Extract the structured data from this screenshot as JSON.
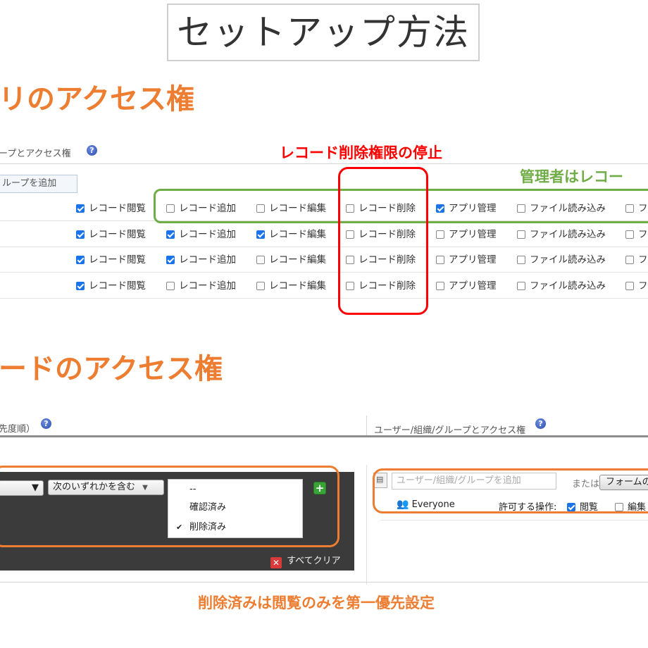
{
  "page_title": "セットアップ方法",
  "app_section": {
    "heading": "リのアクセス権",
    "column_header": "ープとアクセス権",
    "add_group_placeholder": "ループを追加",
    "annotation_red": "レコード削除権限の停止",
    "annotation_green": "管理者はレコー",
    "rows": [
      [
        {
          "label": "レコード閲覧",
          "checked": true
        },
        {
          "label": "レコード追加",
          "checked": false
        },
        {
          "label": "レコード編集",
          "checked": false
        },
        {
          "label": "レコード削除",
          "checked": false
        },
        {
          "label": "アプリ管理",
          "checked": true
        },
        {
          "label": "ファイル読み込み",
          "checked": false
        },
        {
          "label": "フ",
          "checked": false
        }
      ],
      [
        {
          "label": "レコード閲覧",
          "checked": true
        },
        {
          "label": "レコード追加",
          "checked": true
        },
        {
          "label": "レコード編集",
          "checked": true
        },
        {
          "label": "レコード削除",
          "checked": false
        },
        {
          "label": "アプリ管理",
          "checked": false
        },
        {
          "label": "ファイル読み込み",
          "checked": false
        },
        {
          "label": "フ",
          "checked": false
        }
      ],
      [
        {
          "label": "レコード閲覧",
          "checked": true
        },
        {
          "label": "レコード追加",
          "checked": true
        },
        {
          "label": "レコード編集",
          "checked": false
        },
        {
          "label": "レコード削除",
          "checked": false
        },
        {
          "label": "アプリ管理",
          "checked": false
        },
        {
          "label": "ファイル読み込み",
          "checked": false
        },
        {
          "label": "フ",
          "checked": false
        }
      ],
      [
        {
          "label": "レコード閲覧",
          "checked": true
        },
        {
          "label": "レコード追加",
          "checked": false
        },
        {
          "label": "レコード編集",
          "checked": false
        },
        {
          "label": "レコード削除",
          "checked": false
        },
        {
          "label": "アプリ管理",
          "checked": false
        },
        {
          "label": "ファイル読み込み",
          "checked": false
        },
        {
          "label": "フ",
          "checked": false
        }
      ]
    ]
  },
  "record_section": {
    "heading": "ードのアクセス権",
    "left_header": "先度順）",
    "right_header": "ユーザー/組織/グループとアクセス権",
    "condition_select": "次のいずれかを含む",
    "dropdown_options": [
      {
        "label": "--",
        "selected": false
      },
      {
        "label": "確認済み",
        "selected": false
      },
      {
        "label": "削除済み",
        "selected": true
      }
    ],
    "clear_all": "すべてクリア",
    "user_input_placeholder": "ユーザー/組織/グループを追加",
    "or_text": "または",
    "form_button": "フォームの",
    "everyone_label": "Everyone",
    "allowed_ops_label": "許可する操作:",
    "perm_view": {
      "label": "閲覧",
      "checked": true
    },
    "perm_edit": {
      "label": "編集",
      "checked": false
    },
    "caption": "削除済みは閲覧のみを第一優先設定"
  },
  "colors": {
    "orange": "#ed7d31",
    "red": "#ff0000",
    "green": "#70ad47",
    "checkbox_blue": "#1a73e8"
  },
  "icons": {
    "help": "question-circle",
    "add": "plus",
    "clear": "x-mark",
    "users": "people"
  }
}
